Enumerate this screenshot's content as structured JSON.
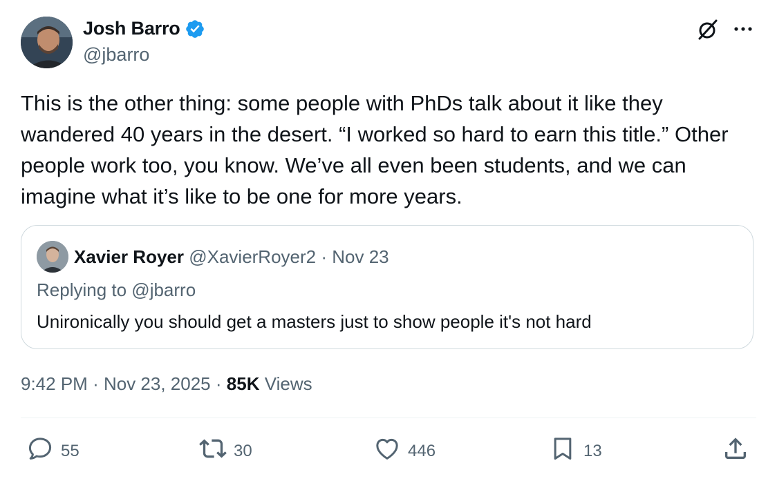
{
  "author": {
    "name": "Josh Barro",
    "handle": "@jbarro",
    "verified": true,
    "verified_color": "#1d9bf0"
  },
  "tweet": {
    "text": "This is the other thing: some people with PhDs talk about it like they\nwandered 40 years in the desert. “I worked so hard to earn this title.” Other\npeople work too, you know. We’ve all even been students, and we can\nimagine what it’s like to be one for more years."
  },
  "quoted": {
    "name": "Xavier Royer",
    "handle": "@XavierRoyer2",
    "date": "Nov 23",
    "separator": "·",
    "replying_to": "Replying to @jbarro",
    "text": "Unironically you should get a masters just to show people it's not hard"
  },
  "meta": {
    "time": "9:42 PM",
    "date": "Nov 23, 2025",
    "separator": "·",
    "views_count": "85K",
    "views_label": "Views"
  },
  "actions": {
    "replies": "55",
    "retweets": "30",
    "likes": "446",
    "bookmarks": "13"
  },
  "icons": {
    "grok": "grok-icon",
    "more": "more-icon",
    "reply": "reply-icon",
    "retweet": "retweet-icon",
    "like": "heart-icon",
    "bookmark": "bookmark-icon",
    "share": "share-icon"
  },
  "colors": {
    "text_primary": "#0f1419",
    "text_secondary": "#536471",
    "border": "#cfd9de",
    "accent": "#1d9bf0"
  }
}
